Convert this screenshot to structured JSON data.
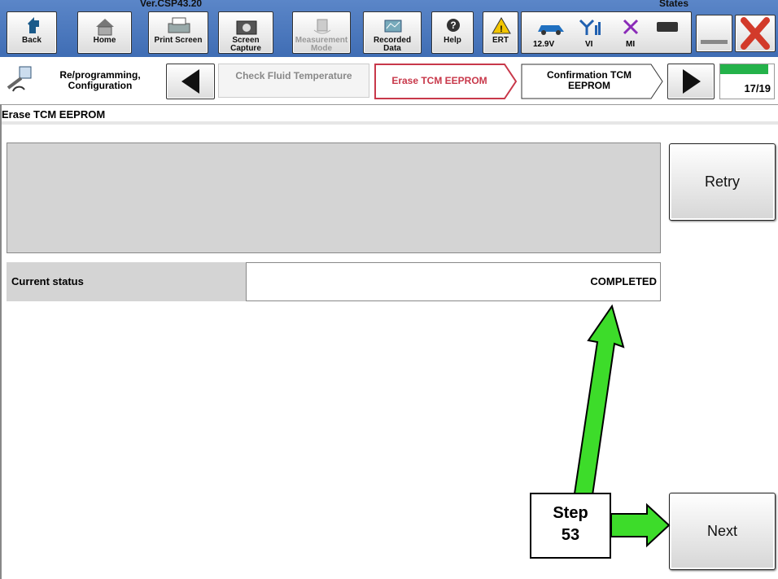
{
  "header": {
    "version": "Ver.CSP43.20",
    "states_label": "States",
    "toolbar": [
      {
        "label": "Back",
        "icon": "back-arrow-icon"
      },
      {
        "label": "Home",
        "icon": "home-icon"
      },
      {
        "label": "Print Screen",
        "icon": "printer-icon"
      },
      {
        "label": "Screen Capture",
        "icon": "camera-icon"
      },
      {
        "label": "Measurement Mode",
        "icon": "measurement-icon"
      },
      {
        "label": "Recorded Data",
        "icon": "recorded-data-icon"
      },
      {
        "label": "Help",
        "icon": "help-icon"
      },
      {
        "label": "ERT",
        "icon": "warning-icon"
      }
    ],
    "status": {
      "voltage": "12.9V",
      "vi": "VI",
      "mi": "MI"
    }
  },
  "breadcrumb": {
    "root": "Re/programming, Configuration",
    "previous": "Check Fluid Temperature",
    "current": "Erase TCM EEPROM",
    "next": "Confirmation TCM EEPROM",
    "progress": "17/19",
    "progress_fraction": 0.89
  },
  "page": {
    "title": "Erase TCM EEPROM",
    "current_status_label": "Current status",
    "current_status_value": "COMPLETED",
    "retry_label": "Retry",
    "next_label": "Next"
  },
  "annotation": {
    "line1": "Step",
    "line2": "53",
    "color": "#3ddc2a"
  }
}
